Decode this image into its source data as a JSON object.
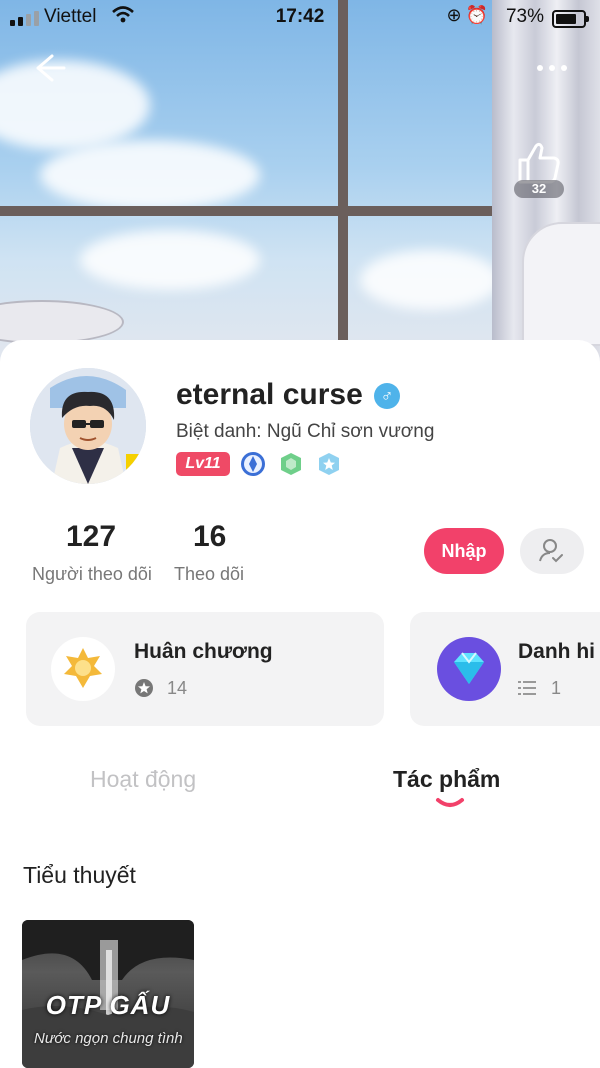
{
  "status_bar": {
    "carrier": "Viettel",
    "time": "17:42",
    "battery": "73%"
  },
  "header": {
    "like_count": "32"
  },
  "profile": {
    "username": "eternal curse",
    "gender_symbol": "♂",
    "nickname": "Biệt danh: Ngũ Chỉ sơn vương",
    "level": "Lv11",
    "badges": [
      "pen-badge-icon",
      "hexagon-badge-icon",
      "star-badge-icon"
    ]
  },
  "stats": {
    "followers_count": "127",
    "followers_label": "Người theo dõi",
    "following_count": "16",
    "following_label": "Theo dõi"
  },
  "actions": {
    "enter_label": "Nhập"
  },
  "achievements": [
    {
      "title": "Huân chương",
      "count": "14"
    },
    {
      "title": "Danh hi",
      "count": "1"
    }
  ],
  "tabs": [
    {
      "label": "Hoạt động",
      "active": false
    },
    {
      "label": "Tác phẩm",
      "active": true
    }
  ],
  "section": {
    "title": "Tiểu thuyết"
  },
  "book": {
    "title": "OTP GẤU",
    "subtitle": "Nước ngọn chung tình"
  },
  "colors": {
    "accent": "#f2416a",
    "level_badge": "#ef4a66",
    "gender": "#4fb3ea"
  }
}
